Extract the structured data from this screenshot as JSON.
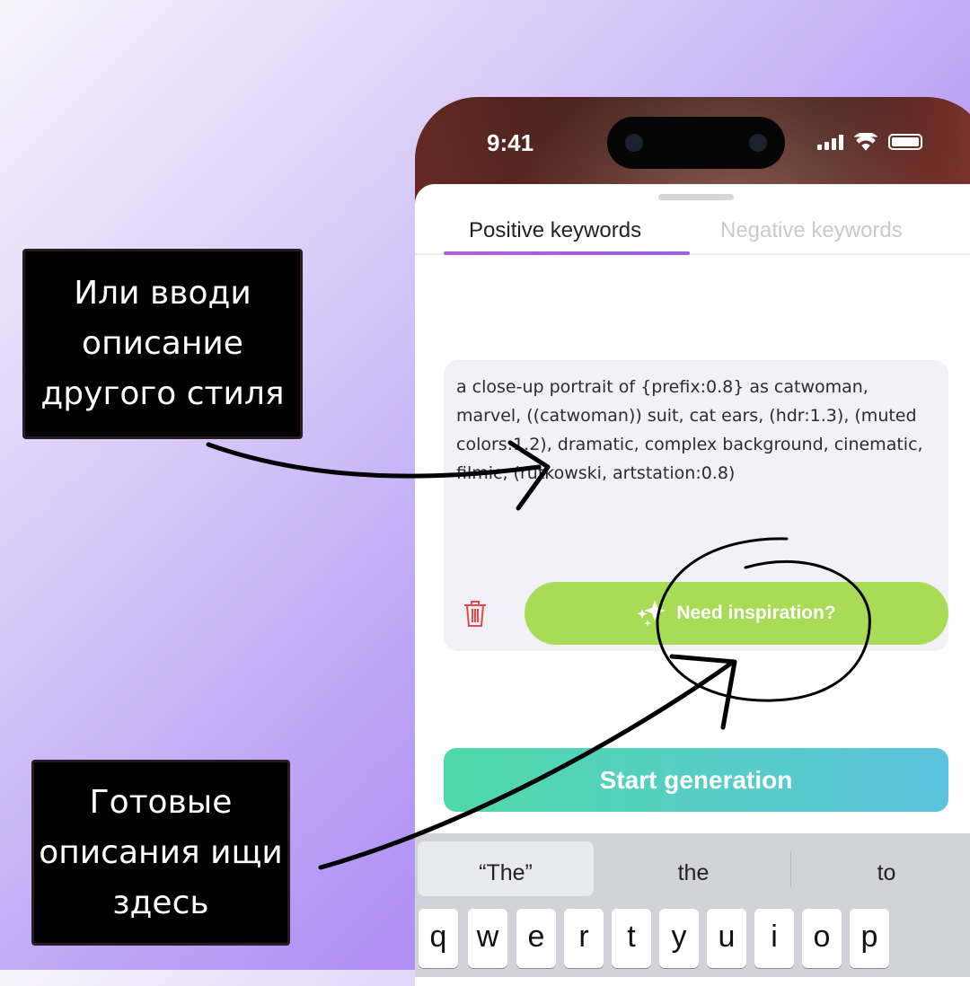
{
  "status_bar": {
    "time": "9:41"
  },
  "tabs": [
    {
      "label": "Positive keywords",
      "active": true
    },
    {
      "label": "Negative keywords",
      "active": false
    }
  ],
  "prompt": {
    "value": "a close-up portrait of {prefix:0.8} as catwoman, marvel, ((catwoman)) suit, cat ears, (hdr:1.3), (muted colors:1.2), dramatic, complex background, cinematic, filmic, (rutkowski, artstation:0.8)"
  },
  "buttons": {
    "inspiration": "Need inspiration?",
    "start": "Start generation",
    "delete_icon": "trash-icon",
    "inspiration_icon": "sparkles-icon"
  },
  "keyboard": {
    "suggestions": [
      "“The”",
      "the",
      "to"
    ],
    "keys": [
      "q",
      "w",
      "e",
      "r",
      "t",
      "y",
      "u",
      "i",
      "o",
      "p"
    ]
  },
  "annotations": {
    "label1": "Или вводи описание другого стиля",
    "label2": "Готовые описания ищи здесь"
  },
  "colors": {
    "accent_green": "#a9dc56",
    "tab_underline": "#b55fd8",
    "start_gradient": [
      "#4fd9a9",
      "#5cc4df"
    ],
    "trash": "#e5484d"
  }
}
